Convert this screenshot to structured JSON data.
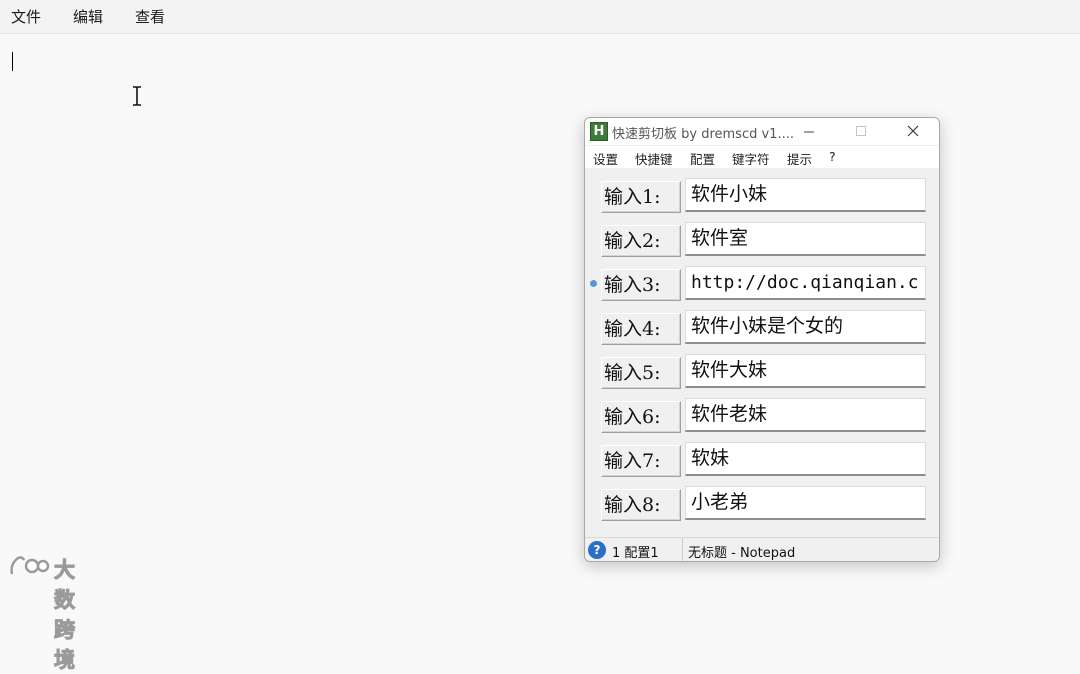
{
  "notepad": {
    "menu": [
      "文件",
      "编辑",
      "查看"
    ]
  },
  "clip_window": {
    "title": "快速剪切板 by dremscd v1....",
    "menu": [
      "设置",
      "快捷键",
      "配置",
      "键字符",
      "提示",
      "?"
    ],
    "rows": [
      {
        "label": "输入1:",
        "value": "软件小妹",
        "active": false
      },
      {
        "label": "输入2:",
        "value": "软件室",
        "active": false
      },
      {
        "label": "输入3:",
        "value": "http://doc.qianqian.c",
        "active": true
      },
      {
        "label": "输入4:",
        "value": "软件小妹是个女的",
        "active": false
      },
      {
        "label": "输入5:",
        "value": "软件大妹",
        "active": false
      },
      {
        "label": "输入6:",
        "value": "软件老妹",
        "active": false
      },
      {
        "label": "输入7:",
        "value": "软妹",
        "active": false
      },
      {
        "label": "输入8:",
        "value": "小老弟",
        "active": false
      }
    ],
    "status": {
      "config": "1 配置1",
      "target": "无标题 - Notepad"
    }
  },
  "watermark": {
    "text": "大数跨境"
  },
  "colors": {
    "accent": "#5a96d6",
    "app_icon": "#3f7a3b",
    "help_icon": "#2a70c8"
  },
  "icons": [
    "h-app-icon",
    "minimize-icon",
    "maximize-icon",
    "close-icon",
    "help-icon",
    "text-cursor-icon"
  ]
}
